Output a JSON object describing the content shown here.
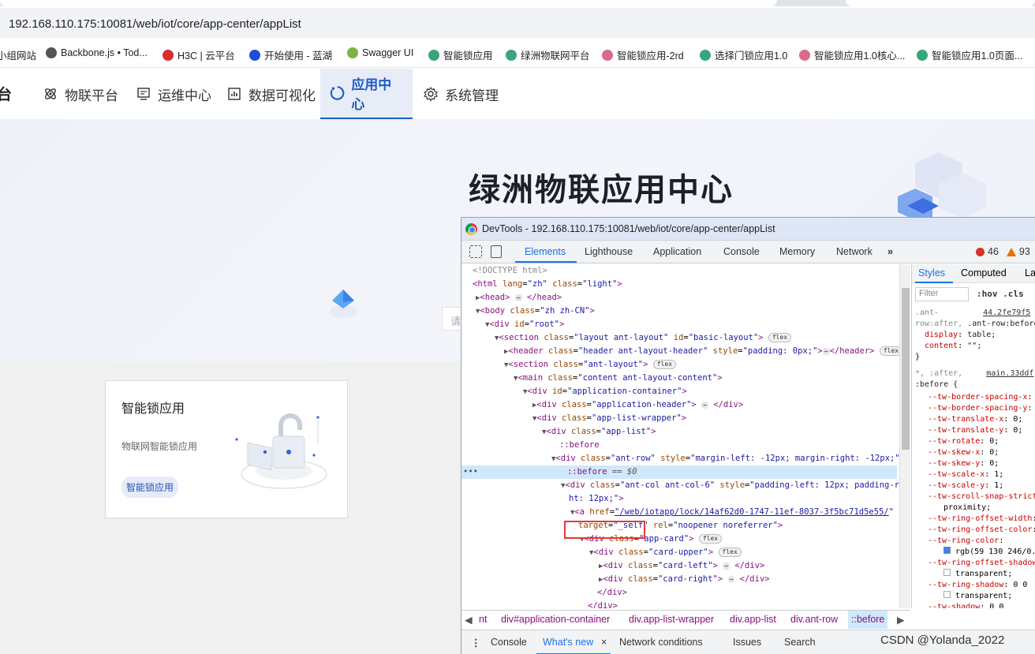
{
  "browser": {
    "url": "192.168.110.175:10081/web/iot/core/app-center/appList",
    "bookmarks": [
      {
        "label": "小组网站",
        "color": "#888888"
      },
      {
        "label": "Backbone.js • Tod...",
        "color": "#555555"
      },
      {
        "label": "H3C | 云平台",
        "color": "#d32f2f"
      },
      {
        "label": "开始使用 - 蓝湖",
        "color": "#1e4fd8"
      },
      {
        "label": "Swagger UI",
        "color": "#7cb342"
      },
      {
        "label": "智能锁应用",
        "color": "#3aa57a"
      },
      {
        "label": "绿洲物联网平台",
        "color": "#3aa57a"
      },
      {
        "label": "智能锁应用-2rd",
        "color": "#d86a8a"
      },
      {
        "label": "选择门锁应用1.0",
        "color": "#3aa57a"
      },
      {
        "label": "智能锁应用1.0核心...",
        "color": "#d86a8a"
      },
      {
        "label": "智能锁应用1.0页面...",
        "color": "#3aa57a"
      }
    ]
  },
  "nav": {
    "logo_tail": "台",
    "items": [
      {
        "label": "物联平台",
        "icon": "atom-icon"
      },
      {
        "label": "运维中心",
        "icon": "monitor-icon"
      },
      {
        "label": "数据可视化",
        "icon": "chart-icon"
      },
      {
        "label": "应用中心",
        "icon": "app-center-icon",
        "active": true
      },
      {
        "label": "系统管理",
        "icon": "gear-icon"
      }
    ]
  },
  "hero": {
    "title": "绿洲物联应用中心",
    "search_tail": "请"
  },
  "card": {
    "title": "智能锁应用",
    "desc": "物联网智能锁应用",
    "tag": "智能锁应用"
  },
  "devtools": {
    "title": "DevTools - 192.168.110.175:10081/web/iot/core/app-center/appList",
    "tabs": [
      "Elements",
      "Lighthouse",
      "Application",
      "Console",
      "Memory",
      "Network",
      "»"
    ],
    "errors": "46",
    "warnings": "93",
    "side_tabs": [
      "Styles",
      "Computed",
      "La"
    ],
    "filter_placeholder": "Filter",
    "hov_cls": ":hov .cls",
    "crumbs": [
      "nt",
      "div#application-container",
      "div.app-list-wrapper",
      "div.app-list",
      "div.ant-row",
      "::before"
    ],
    "drawer": [
      "Console",
      "What's new",
      "×",
      "Network conditions",
      "Issues",
      "Search"
    ]
  },
  "watermark": "CSDN @Yolanda_2022"
}
